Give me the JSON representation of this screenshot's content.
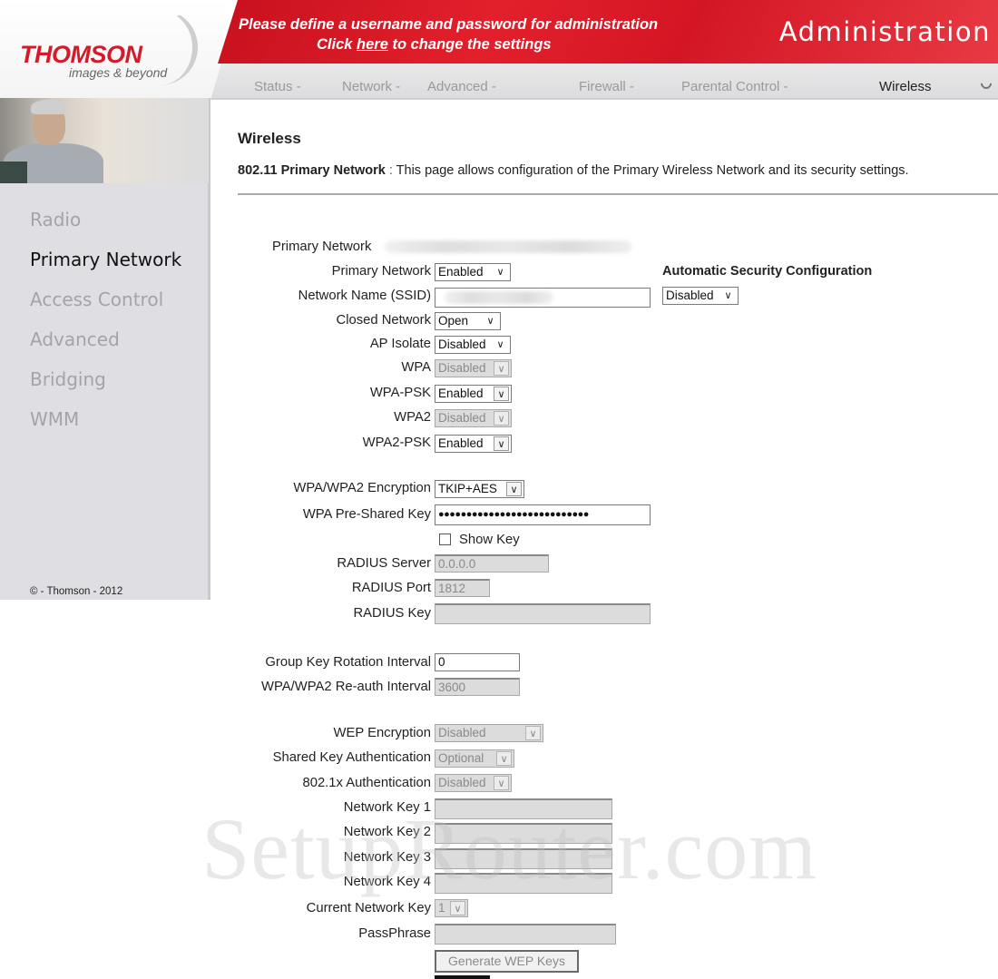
{
  "brand": {
    "name": "THOMSON",
    "tagline": "images & beyond",
    "accent": "#d51a2a"
  },
  "banner": {
    "line1": "Please define a username and password for administration",
    "line2_pre": "Click ",
    "line2_link": "here",
    "line2_post": " to change the settings",
    "title": "Administration"
  },
  "menu": {
    "items": [
      {
        "label": "Status -",
        "active": false
      },
      {
        "label": "Network -",
        "active": false
      },
      {
        "label": "Advanced -",
        "active": false
      },
      {
        "label": "Firewall -",
        "active": false
      },
      {
        "label": "Parental Control -",
        "active": false
      },
      {
        "label": "Wireless",
        "active": true
      }
    ],
    "spinner_icon": "loading-spinner-icon"
  },
  "sidebar": {
    "items": [
      {
        "label": "Radio",
        "active": false
      },
      {
        "label": "Primary Network",
        "active": true
      },
      {
        "label": "Access Control",
        "active": false
      },
      {
        "label": "Advanced",
        "active": false
      },
      {
        "label": "Bridging",
        "active": false
      },
      {
        "label": "WMM",
        "active": false
      }
    ],
    "copyright": "© - Thomson - 2012"
  },
  "page": {
    "title": "Wireless",
    "desc_bold": "802.11 Primary Network",
    "desc_sep": " : ",
    "desc_text": "This page allows configuration of the Primary Wireless Network and its security settings."
  },
  "form": {
    "primary_network_info_label": "Primary Network",
    "primary_network_label": "Primary Network",
    "primary_network_value": "Enabled",
    "ssid_label": "Network Name (SSID)",
    "closed_network_label": "Closed Network",
    "closed_network_value": "Open",
    "ap_isolate_label": "AP Isolate",
    "ap_isolate_value": "Disabled",
    "wpa_label": "WPA",
    "wpa_value": "Disabled",
    "wpa_psk_label": "WPA-PSK",
    "wpa_psk_value": "Enabled",
    "wpa2_label": "WPA2",
    "wpa2_value": "Disabled",
    "wpa2_psk_label": "WPA2-PSK",
    "wpa2_psk_value": "Enabled",
    "encryption_label": "WPA/WPA2 Encryption",
    "encryption_value": "TKIP+AES",
    "psk_label": "WPA Pre-Shared Key",
    "psk_value": "●●●●●●●●●●●●●●●●●●●●●●●●●●●",
    "show_key_label": "Show Key",
    "show_key_checked": false,
    "radius_server_label": "RADIUS Server",
    "radius_server_value": "0.0.0.0",
    "radius_port_label": "RADIUS Port",
    "radius_port_value": "1812",
    "radius_key_label": "RADIUS Key",
    "radius_key_value": "",
    "group_key_label": "Group Key Rotation Interval",
    "group_key_value": "0",
    "reauth_label": "WPA/WPA2 Re-auth Interval",
    "reauth_value": "3600",
    "wep_label": "WEP Encryption",
    "wep_value": "Disabled",
    "shared_key_auth_label": "Shared Key Authentication",
    "shared_key_auth_value": "Optional",
    "dot1x_label": "802.1x Authentication",
    "dot1x_value": "Disabled",
    "network_key1_label": "Network Key 1",
    "network_key2_label": "Network Key 2",
    "network_key3_label": "Network Key 3",
    "network_key4_label": "Network Key 4",
    "current_key_label": "Current Network Key",
    "current_key_value": "1",
    "passphrase_label": "PassPhrase",
    "generate_button": "Generate WEP Keys"
  },
  "auto_security": {
    "title": "Automatic Security Configuration",
    "value": "Disabled"
  },
  "watermark": "SetupRouter.com"
}
